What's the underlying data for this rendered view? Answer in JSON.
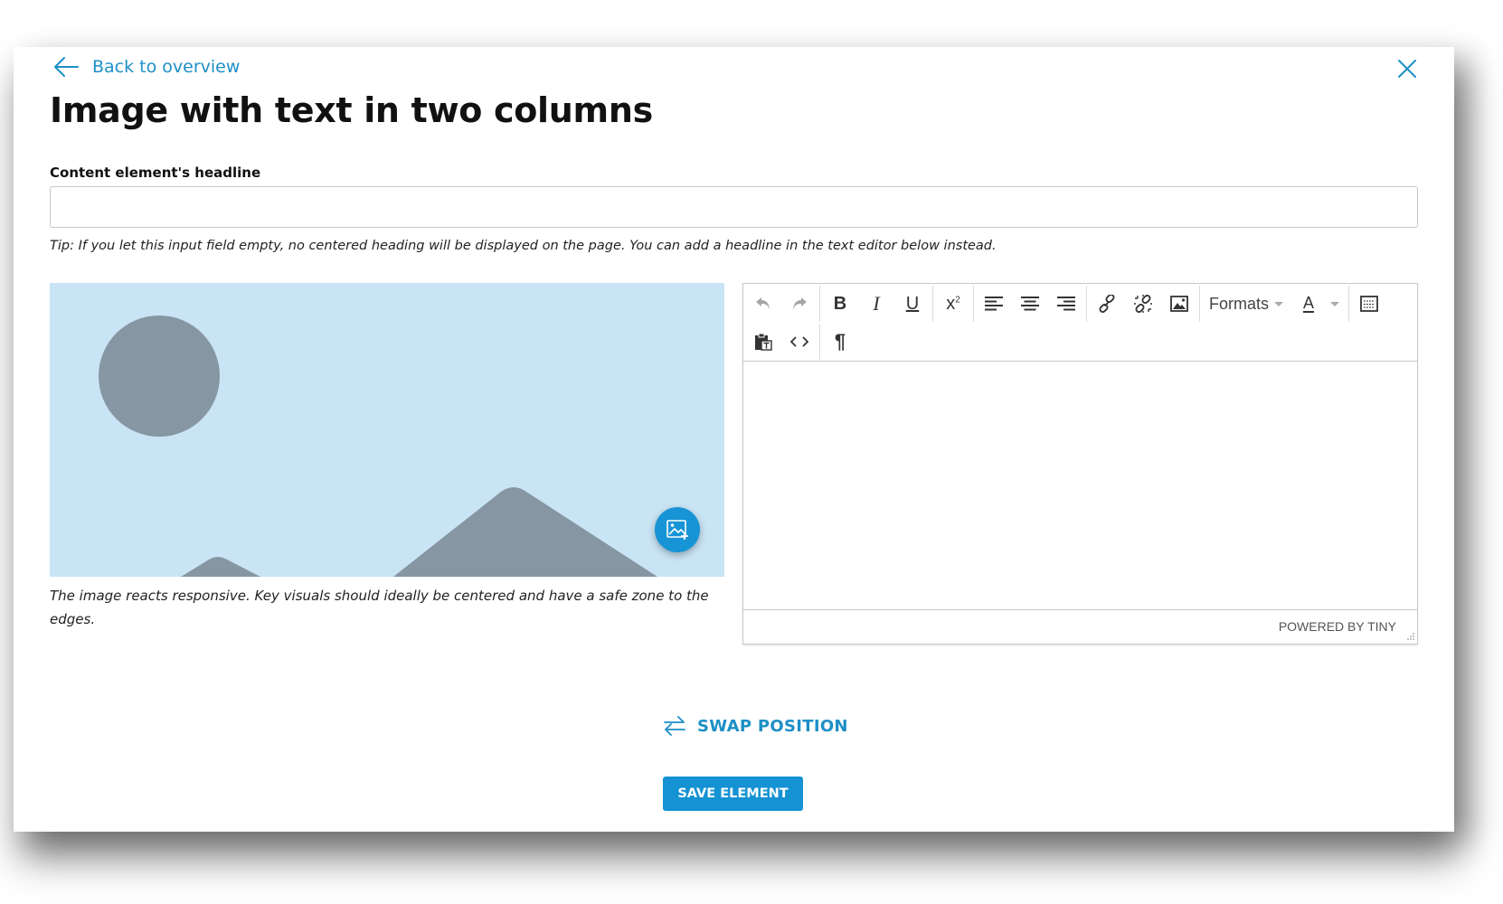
{
  "header": {
    "back_label": "Back to overview",
    "title": "Image with text in two columns"
  },
  "headline_field": {
    "label": "Content element's headline",
    "value": "",
    "placeholder": "",
    "tip": "Tip: If you let this input field empty, no centered heading will be displayed on the page. You can add a headline in the text editor below instead."
  },
  "image": {
    "placeholder_colors": {
      "background": "#c9e4f4",
      "shapes": "#8696a2"
    },
    "change_image_button": "image-add-icon",
    "caption": "The image reacts responsive. Key visuals should ideally be centered and have a safe zone to the edges."
  },
  "editor": {
    "toolbar_row1": [
      [
        "undo-icon",
        "redo-icon"
      ],
      [
        "bold-icon",
        "italic-icon",
        "underline-icon"
      ],
      [
        "superscript-icon"
      ],
      [
        "align-left-icon",
        "align-center-icon",
        "align-right-icon"
      ],
      [
        "link-icon",
        "unlink-icon",
        "image-icon"
      ],
      [
        "formats-dropdown",
        "text-color-dropdown"
      ],
      [
        "table-icon"
      ]
    ],
    "toolbar_row2": [
      [
        "paste-as-text-icon",
        "source-code-icon"
      ],
      [
        "show-blocks-icon"
      ]
    ],
    "formats_label": "Formats",
    "text_color_label": "A",
    "content": "",
    "powered_by": "POWERED BY TINY"
  },
  "actions": {
    "swap_label": "SWAP POSITION",
    "save_label": "SAVE ELEMENT"
  },
  "colors": {
    "accent": "#1d8fc6",
    "button": "#1592d3"
  }
}
